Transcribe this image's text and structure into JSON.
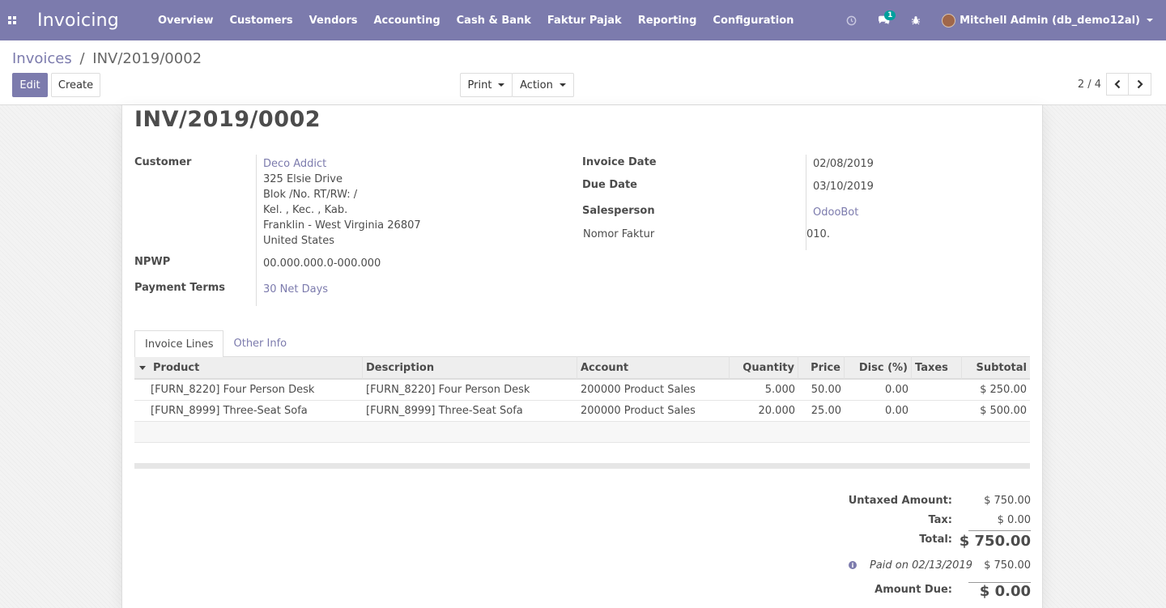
{
  "navbar": {
    "app_name": "Invoicing",
    "menu": [
      "Overview",
      "Customers",
      "Vendors",
      "Accounting",
      "Cash & Bank",
      "Faktur Pajak",
      "Reporting",
      "Configuration"
    ],
    "chat_badge": "1",
    "user": "Mitchell Admin (db_demo12al)"
  },
  "breadcrumb": {
    "parent": "Invoices",
    "separator": "/",
    "current": "INV/2019/0002"
  },
  "buttons": {
    "edit": "Edit",
    "create": "Create",
    "print": "Print",
    "action": "Action"
  },
  "pager": {
    "value": "2 / 4"
  },
  "invoice": {
    "title": "INV/2019/0002",
    "customer_label": "Customer",
    "customer_name": "Deco Addict",
    "address": [
      "325 Elsie Drive",
      "Blok /No. RT/RW: /",
      "Kel. , Kec. , Kab.",
      "Franklin - West Virginia 26807",
      "United States"
    ],
    "npwp_label": "NPWP",
    "npwp": "00.000.000.0-000.000",
    "payment_terms_label": "Payment Terms",
    "payment_terms": "30 Net Days",
    "invoice_date_label": "Invoice Date",
    "invoice_date": "02/08/2019",
    "due_date_label": "Due Date",
    "due_date": "03/10/2019",
    "salesperson_label": "Salesperson",
    "salesperson": "OdooBot",
    "nomor_faktur_label": "Nomor Faktur",
    "nomor_faktur": "010."
  },
  "tabs": [
    "Invoice Lines",
    "Other Info"
  ],
  "table": {
    "headers": [
      "Product",
      "Description",
      "Account",
      "Quantity",
      "Price",
      "Disc (%)",
      "Taxes",
      "Subtotal"
    ],
    "rows": [
      [
        "[FURN_8220] Four Person Desk",
        "[FURN_8220] Four Person Desk",
        "200000 Product Sales",
        "5.000",
        "50.00",
        "0.00",
        "",
        "$ 250.00"
      ],
      [
        "[FURN_8999] Three-Seat Sofa",
        "[FURN_8999] Three-Seat Sofa",
        "200000 Product Sales",
        "20.000",
        "25.00",
        "0.00",
        "",
        "$ 500.00"
      ]
    ]
  },
  "totals": {
    "untaxed_label": "Untaxed Amount:",
    "untaxed": "$ 750.00",
    "tax_label": "Tax:",
    "tax": "$ 0.00",
    "total_label": "Total:",
    "total": "$ 750.00",
    "paid_label": "Paid on 02/13/2019",
    "paid": "$ 750.00",
    "amount_due_label": "Amount Due:",
    "amount_due": "$ 0.00"
  },
  "colors": {
    "brand": "#7c7bad",
    "badge": "#00a09d"
  }
}
